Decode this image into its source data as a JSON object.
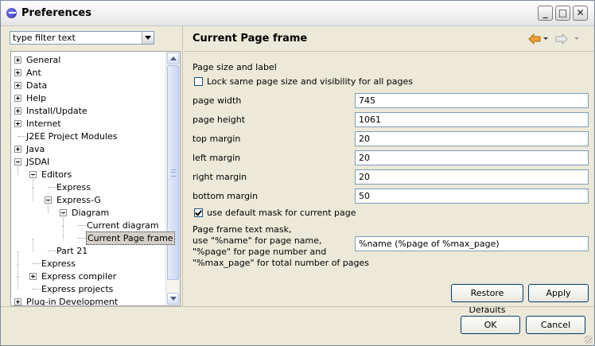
{
  "window": {
    "title": "Preferences"
  },
  "filter": {
    "text": "type filter text"
  },
  "tree": {
    "items": [
      {
        "label": "General",
        "level": 0,
        "toggle": "plus"
      },
      {
        "label": "Ant",
        "level": 0,
        "toggle": "plus"
      },
      {
        "label": "Data",
        "level": 0,
        "toggle": "plus"
      },
      {
        "label": "Help",
        "level": 0,
        "toggle": "plus"
      },
      {
        "label": "Install/Update",
        "level": 0,
        "toggle": "plus"
      },
      {
        "label": "Internet",
        "level": 0,
        "toggle": "plus"
      },
      {
        "label": "J2EE Project Modules",
        "level": 0,
        "toggle": "none"
      },
      {
        "label": "Java",
        "level": 0,
        "toggle": "plus"
      },
      {
        "label": "JSDAI",
        "level": 0,
        "toggle": "minus"
      },
      {
        "label": "Editors",
        "level": 1,
        "toggle": "minus"
      },
      {
        "label": "Express",
        "level": 2,
        "toggle": "none"
      },
      {
        "label": "Express-G",
        "level": 2,
        "toggle": "minus"
      },
      {
        "label": "Diagram",
        "level": 3,
        "toggle": "minus"
      },
      {
        "label": "Current diagram",
        "level": 4,
        "toggle": "none"
      },
      {
        "label": "Current Page frame",
        "level": 4,
        "toggle": "none",
        "selected": true
      },
      {
        "label": "Part 21",
        "level": 2,
        "toggle": "none"
      },
      {
        "label": "Express",
        "level": 1,
        "toggle": "none"
      },
      {
        "label": "Express compiler",
        "level": 1,
        "toggle": "plus"
      },
      {
        "label": "Express projects",
        "level": 1,
        "toggle": "none"
      },
      {
        "label": "Plug-in Development",
        "level": 0,
        "toggle": "plus"
      }
    ]
  },
  "page": {
    "title": "Current Page frame",
    "section_label": "Page size and label",
    "lock_label": "Lock same page size and visibility for all pages",
    "lock_checked": false,
    "fields": [
      {
        "label": "page width",
        "value": "745"
      },
      {
        "label": "page height",
        "value": "1061"
      },
      {
        "label": "top margin",
        "value": "20"
      },
      {
        "label": "left margin",
        "value": "20"
      },
      {
        "label": "right margin",
        "value": "20"
      },
      {
        "label": "bottom margin",
        "value": "50"
      }
    ],
    "default_mask_label": "use default mask for current page",
    "default_mask_checked": true,
    "mask_text": [
      "Page frame text mask,",
      "use \"%name\" for page name,",
      "\"%page\" for page number and",
      "\"%max_page\" for total number of pages"
    ],
    "mask_value": "%name (%page of %max_page)"
  },
  "buttons": {
    "restore": "Restore Defaults",
    "apply": "Apply",
    "ok": "OK",
    "cancel": "Cancel"
  },
  "icons": {
    "back": "back-arrow-icon",
    "forward": "forward-arrow-icon"
  },
  "colors": {
    "dialog_bg": "#ece9d8",
    "back_arrow": "#f0a030",
    "button_border": "#003c74"
  }
}
